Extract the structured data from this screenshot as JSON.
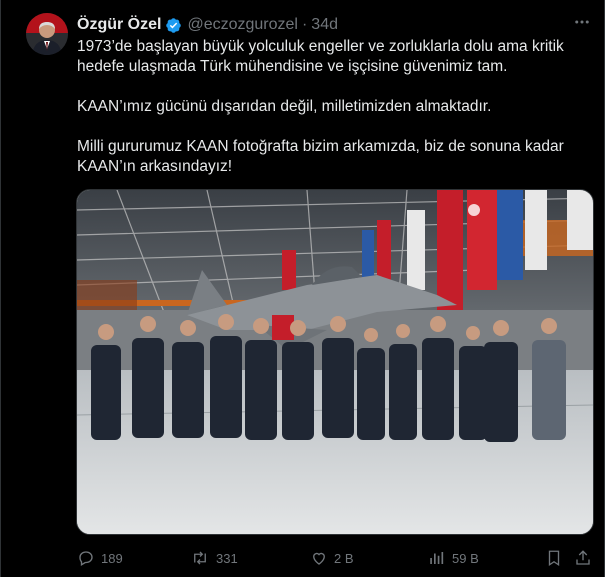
{
  "author": {
    "name": "Özgür Özel",
    "handle": "@eczozgurozel",
    "dot": "·",
    "time": "34d"
  },
  "body": {
    "line1": "1973’de başlayan büyük yolculuk engeller ve zorluklarla dolu ama kritik hedefe ulaşmada Türk mühendisine ve işçisine güvenimiz tam.",
    "line2": "KAAN’ımız gücünü dışarıdan değil, milletimizden almaktadır.",
    "line3": "Milli gururumuz KAAN fotoğrafta bizim arkamızda, biz de sonuna kadar KAAN’ın arkasındayız!"
  },
  "actions": {
    "replies": "189",
    "reposts": "331",
    "likes": "2 B",
    "views": "59 B"
  },
  "colors": {
    "background": "#000000",
    "text": "#e7e9ea",
    "muted": "#71767b",
    "verified": "#1d9bf0"
  },
  "icons": [
    "verified-icon",
    "more-icon",
    "reply-icon",
    "repost-icon",
    "like-icon",
    "views-icon",
    "bookmark-icon",
    "share-icon"
  ]
}
